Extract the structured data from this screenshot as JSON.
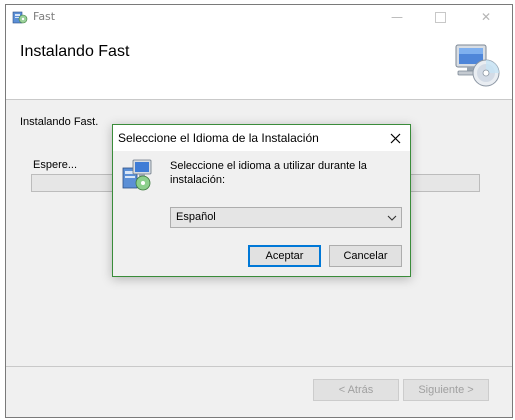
{
  "window": {
    "title": "Fast",
    "header_title": "Instalando Fast",
    "status_text": "Instalando Fast.",
    "wait_label": "Espere...",
    "progress": 0.0
  },
  "footer": {
    "back_label": "< Atrás",
    "next_label": "Siguiente >"
  },
  "dialog": {
    "title": "Seleccione el Idioma de la Instalación",
    "message": "Seleccione el idioma a utilizar durante la instalación:",
    "selected_language": "Español",
    "ok_label": "Aceptar",
    "cancel_label": "Cancelar"
  },
  "colors": {
    "dialog_border": "#3a8c3a",
    "default_button_border": "#0078d7",
    "progress_fill": "#9cb0c9"
  }
}
